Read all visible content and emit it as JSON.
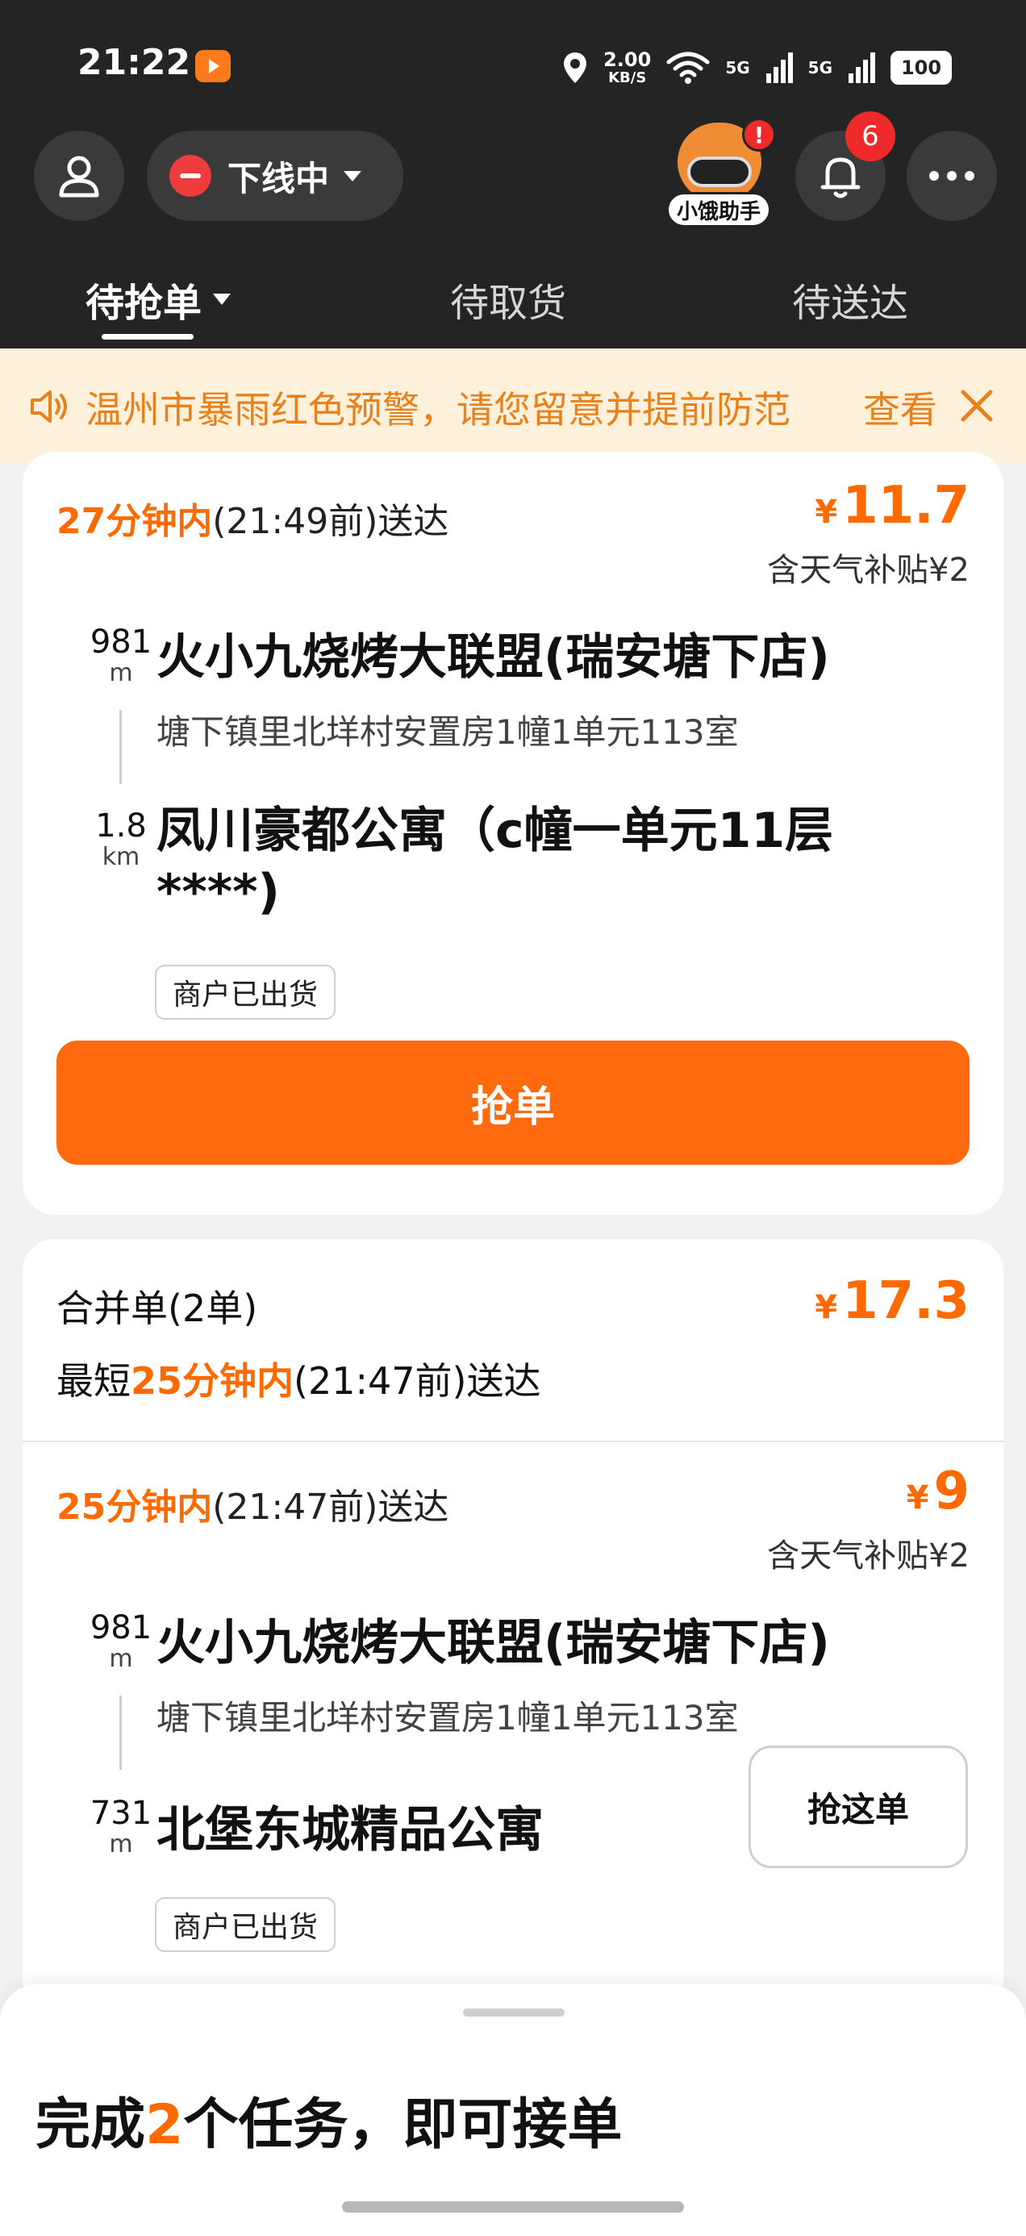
{
  "status_bar": {
    "time": "21:22",
    "net_speed_value": "2.00",
    "net_speed_unit": "KB/S",
    "signal1_label": "5G",
    "signal2_label": "5G",
    "battery": "100"
  },
  "header": {
    "status_label": "下线中",
    "assistant_label": "小饿助手",
    "assistant_alert": "!",
    "notification_count": "6"
  },
  "tabs": [
    {
      "label": "待抢单",
      "active": true
    },
    {
      "label": "待取货",
      "active": false
    },
    {
      "label": "待送达",
      "active": false
    }
  ],
  "notice": {
    "text": "温州市暴雨红色预警，请您留意并提前防范",
    "link": "查看"
  },
  "order1": {
    "eta_highlight": "27分钟内",
    "eta_rest": "(21:49前)送达",
    "currency": "¥",
    "price": "11.7",
    "subsidy": "含天气补贴¥2",
    "pickup_distance": "981",
    "pickup_unit": "m",
    "shop_name": "火小九烧烤大联盟(瑞安塘下店)",
    "shop_address": "塘下镇里北垟村安置房1幢1单元113室",
    "dropoff_distance": "1.8",
    "dropoff_unit": "km",
    "destination_line1": "凤川豪都公寓（c幢一单元11层",
    "destination_line2": "****)",
    "tag": "商户已出货",
    "grab_button": "抢单"
  },
  "order2": {
    "merge_title": "合并单(2单)",
    "currency": "¥",
    "total_price": "17.3",
    "merge_eta_prefix": "最短",
    "merge_eta_highlight": "25分钟内",
    "merge_eta_rest": "(21:47前)送达",
    "sub_eta_highlight": "25分钟内",
    "sub_eta_rest": "(21:47前)送达",
    "sub_price": "9",
    "subsidy": "含天气补贴¥2",
    "pickup_distance": "981",
    "pickup_unit": "m",
    "shop_name": "火小九烧烤大联盟(瑞安塘下店)",
    "shop_address": "塘下镇里北垟村安置房1幢1单元113室",
    "dropoff_distance": "731",
    "dropoff_unit": "m",
    "destination": "北堡东城精品公寓",
    "grab_this_button": "抢这单",
    "tag": "商户已出货"
  },
  "sheet": {
    "title_prefix": "完成",
    "title_number": "2",
    "title_suffix": "个任务，即可接单"
  },
  "colors": {
    "accent": "#ff6a00",
    "header_bg": "#242424",
    "notice_bg": "#fdf1dc",
    "notice_text": "#e8801c",
    "offline_red": "#ee3b3b"
  }
}
